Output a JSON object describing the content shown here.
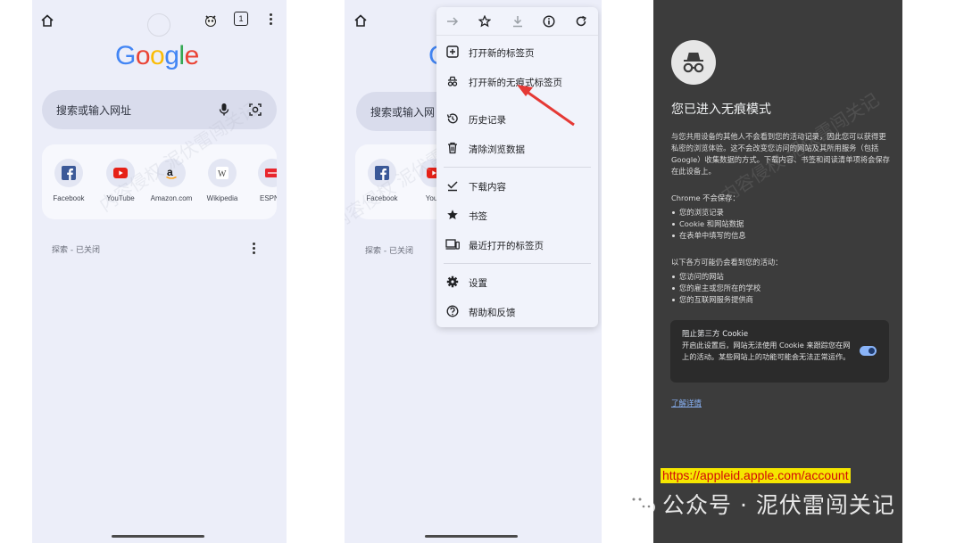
{
  "screen1": {
    "search_placeholder": "搜索或输入网址",
    "tab_count": "1",
    "shortcuts": [
      {
        "label": "Facebook"
      },
      {
        "label": "YouTube"
      },
      {
        "label": "Amazon.com"
      },
      {
        "label": "Wikipedia"
      },
      {
        "label": "ESPN.c"
      }
    ],
    "discover_label": "探索 - 已关闭"
  },
  "screen2": {
    "search_placeholder": "搜索或输入网",
    "shortcuts": [
      {
        "label": "Facebook"
      },
      {
        "label": "YouT"
      }
    ],
    "discover_label": "探索 - 已关闭",
    "menu": {
      "items": [
        {
          "label": "打开新的标签页",
          "icon": "plus-box-icon"
        },
        {
          "label": "打开新的无痕式标签页",
          "icon": "incognito-icon"
        },
        {
          "label": "历史记录",
          "icon": "history-icon"
        },
        {
          "label": "清除浏览数据",
          "icon": "trash-icon"
        },
        {
          "label": "下载内容",
          "icon": "download-check-icon"
        },
        {
          "label": "书签",
          "icon": "star-icon"
        },
        {
          "label": "最近打开的标签页",
          "icon": "devices-icon"
        },
        {
          "label": "设置",
          "icon": "gear-icon"
        },
        {
          "label": "帮助和反馈",
          "icon": "help-icon"
        }
      ]
    }
  },
  "screen3": {
    "title": "您已进入无痕模式",
    "intro": "与您共用设备的其他人不会看到您的活动记录，因此您可以获得更私密的浏览体验。这不会改变您访问的网站及其所用服务（包括 Google）收集数据的方式。下载内容、书签和阅读清单项将会保存在此设备上。",
    "not_saved_heading": "Chrome 不会保存：",
    "not_saved_items": [
      "您的浏览记录",
      "Cookie 和网站数据",
      "在表单中填写的信息"
    ],
    "visible_heading": "以下各方可能仍会看到您的活动：",
    "visible_items": [
      "您访问的网站",
      "您的雇主或您所在的学校",
      "您的互联网服务提供商"
    ],
    "cookie_title": "阻止第三方 Cookie",
    "cookie_desc": "开启此设置后，网站无法使用 Cookie 来跟踪您在网上的活动。某些网站上的功能可能会无法正常运作。",
    "learn_more": "了解详情"
  },
  "overlay": {
    "url_banner": "https://appleid.apple.com/account",
    "footer_watermark": "公众号 · 泥伏雷闯关记",
    "diagonal_watermark": "内容侵权 泥伏雷闯关记"
  },
  "colors": {
    "phone_bg": "#eceef9",
    "incognito_bg": "#3c3c3c",
    "arrow": "#e53935",
    "link": "#8ab4f8",
    "banner_bg": "#f5e600",
    "banner_text": "#d10a0a"
  }
}
